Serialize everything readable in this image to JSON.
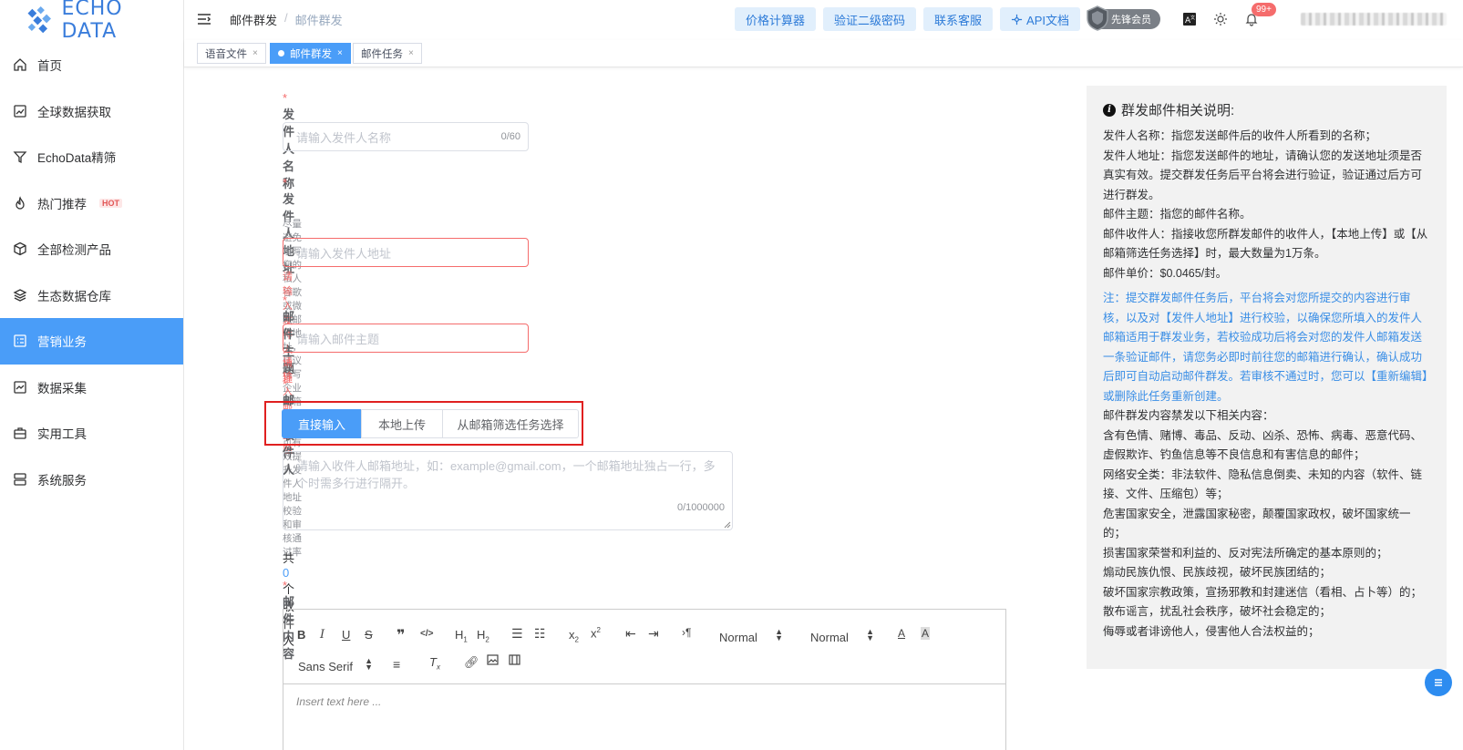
{
  "brand": {
    "name": "ECHO DATA",
    "color": "#3a7ddb"
  },
  "sidebar": {
    "items": [
      {
        "label": "首页",
        "icon": "home-icon"
      },
      {
        "label": "全球数据获取",
        "icon": "chart-icon"
      },
      {
        "label": "EchoData精筛",
        "icon": "filter-icon"
      },
      {
        "label": "热门推荐",
        "icon": "fire-icon",
        "badge": "HOT"
      },
      {
        "label": "全部检测产品",
        "icon": "cube-icon"
      },
      {
        "label": "生态数据仓库",
        "icon": "layers-icon"
      },
      {
        "label": "营销业务",
        "icon": "list-icon",
        "active": true
      },
      {
        "label": "数据采集",
        "icon": "trend-icon"
      },
      {
        "label": "实用工具",
        "icon": "briefcase-icon"
      },
      {
        "label": "系统服务",
        "icon": "server-icon"
      }
    ]
  },
  "header": {
    "breadcrumb": [
      "邮件群发",
      "邮件群发"
    ],
    "buttons": [
      "价格计算器",
      "验证二级密码",
      "联系客服",
      "API文档"
    ],
    "member": "先锋会员",
    "notifications": "99+"
  },
  "tabs": [
    {
      "label": "语音文件",
      "active": false
    },
    {
      "label": "邮件群发",
      "active": true
    },
    {
      "label": "邮件任务",
      "active": false
    }
  ],
  "form": {
    "sender_name": {
      "label": "发件人名称",
      "placeholder": "请输入发件人名称",
      "counter": "0/60"
    },
    "sender_address": {
      "label": "发件人地址",
      "hint": "尽量避免填写您的私人谷歌或微软邮箱地址，建议填写企业邮箱地址，可有效提升发件人地址校验和审核通过率",
      "placeholder": "请输入发件人地址",
      "error": "请输入发件人地址"
    },
    "subject": {
      "label": "邮件主题",
      "placeholder": "请输入邮件主题",
      "error": "请输入邮件主题"
    },
    "recipients": {
      "label": "邮件收件人",
      "sources": [
        "直接输入",
        "本地上传",
        "从邮箱筛选任务选择"
      ],
      "placeholder": "请输入收件人邮箱地址，如：example@gmail.com，一个邮箱地址独占一行，多个时需多行进行隔开。",
      "counter": "0/1000000",
      "total_prefix": "共",
      "total_count": "0",
      "total_suffix": "个收件人"
    },
    "content": {
      "label": "邮件内容",
      "heading_select": "Normal",
      "size_select": "Normal",
      "font_select": "Sans Serif",
      "placeholder": "Insert text here ..."
    }
  },
  "info": {
    "title": "群发邮件相关说明:",
    "lines": [
      "发件人名称：指您发送邮件后的收件人所看到的名称；",
      "发件人地址：指您发送邮件的地址，请确认您的发送地址须是否真实有效。提交群发任务后平台将会进行验证，验证通过后方可进行群发。",
      "邮件主题：指您的邮件名称。",
      "邮件收件人：指接收您所群发邮件的收件人，【本地上传】或【从邮箱筛选任务选择】时，最大数量为1万条。",
      "邮件单价：$0.0465/封。"
    ],
    "note": "注：提交群发邮件任务后，平台将会对您所提交的内容进行审核，以及对【发件人地址】进行校验，以确保您所填入的发件人邮箱适用于群发业务，若校验成功后将会对您的发件人邮箱发送一条验证邮件，请您务必即时前往您的邮箱进行确认，确认成功后即可自动启动邮件群发。若审核不通过时，您可以【重新编辑】或删除此任务重新创建。",
    "rules": [
      "邮件群发内容禁发以下相关内容：",
      "含有色情、赌博、毒品、反动、凶杀、恐怖、病毒、恶意代码、虚假欺诈、钓鱼信息等不良信息和有害信息的邮件；",
      "网络安全类：非法软件、隐私信息倒卖、未知的内容（软件、链接、文件、压缩包）等；",
      "危害国家安全，泄露国家秘密，颠覆国家政权，破坏国家统一的；",
      "损害国家荣誉和利益的、反对宪法所确定的基本原则的；",
      "煽动民族仇恨、民族歧视，破坏民族团结的；",
      "破坏国家宗教政策，宣扬邪教和封建迷信（看相、占卜等）的；",
      "散布谣言，扰乱社会秩序，破坏社会稳定的；",
      "侮辱或者诽谤他人，侵害他人合法权益的；"
    ]
  },
  "colors": {
    "accent": "#4a9df8",
    "error": "#f56c6c",
    "note": "#3a8ee6",
    "highlight_box": "#e02020"
  }
}
